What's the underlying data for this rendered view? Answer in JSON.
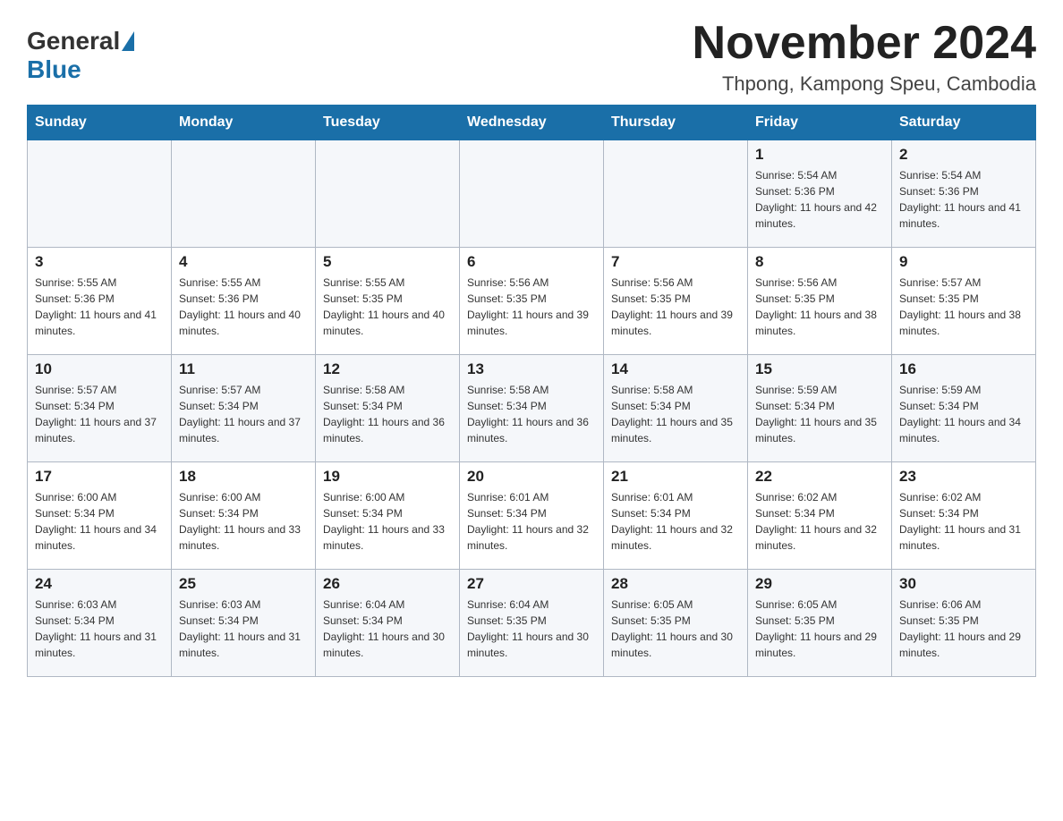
{
  "header": {
    "logo_general": "General",
    "logo_blue": "Blue",
    "month_title": "November 2024",
    "location": "Thpong, Kampong Speu, Cambodia"
  },
  "days_of_week": [
    "Sunday",
    "Monday",
    "Tuesday",
    "Wednesday",
    "Thursday",
    "Friday",
    "Saturday"
  ],
  "weeks": [
    [
      {
        "day": "",
        "sunrise": "",
        "sunset": "",
        "daylight": ""
      },
      {
        "day": "",
        "sunrise": "",
        "sunset": "",
        "daylight": ""
      },
      {
        "day": "",
        "sunrise": "",
        "sunset": "",
        "daylight": ""
      },
      {
        "day": "",
        "sunrise": "",
        "sunset": "",
        "daylight": ""
      },
      {
        "day": "",
        "sunrise": "",
        "sunset": "",
        "daylight": ""
      },
      {
        "day": "1",
        "sunrise": "Sunrise: 5:54 AM",
        "sunset": "Sunset: 5:36 PM",
        "daylight": "Daylight: 11 hours and 42 minutes."
      },
      {
        "day": "2",
        "sunrise": "Sunrise: 5:54 AM",
        "sunset": "Sunset: 5:36 PM",
        "daylight": "Daylight: 11 hours and 41 minutes."
      }
    ],
    [
      {
        "day": "3",
        "sunrise": "Sunrise: 5:55 AM",
        "sunset": "Sunset: 5:36 PM",
        "daylight": "Daylight: 11 hours and 41 minutes."
      },
      {
        "day": "4",
        "sunrise": "Sunrise: 5:55 AM",
        "sunset": "Sunset: 5:36 PM",
        "daylight": "Daylight: 11 hours and 40 minutes."
      },
      {
        "day": "5",
        "sunrise": "Sunrise: 5:55 AM",
        "sunset": "Sunset: 5:35 PM",
        "daylight": "Daylight: 11 hours and 40 minutes."
      },
      {
        "day": "6",
        "sunrise": "Sunrise: 5:56 AM",
        "sunset": "Sunset: 5:35 PM",
        "daylight": "Daylight: 11 hours and 39 minutes."
      },
      {
        "day": "7",
        "sunrise": "Sunrise: 5:56 AM",
        "sunset": "Sunset: 5:35 PM",
        "daylight": "Daylight: 11 hours and 39 minutes."
      },
      {
        "day": "8",
        "sunrise": "Sunrise: 5:56 AM",
        "sunset": "Sunset: 5:35 PM",
        "daylight": "Daylight: 11 hours and 38 minutes."
      },
      {
        "day": "9",
        "sunrise": "Sunrise: 5:57 AM",
        "sunset": "Sunset: 5:35 PM",
        "daylight": "Daylight: 11 hours and 38 minutes."
      }
    ],
    [
      {
        "day": "10",
        "sunrise": "Sunrise: 5:57 AM",
        "sunset": "Sunset: 5:34 PM",
        "daylight": "Daylight: 11 hours and 37 minutes."
      },
      {
        "day": "11",
        "sunrise": "Sunrise: 5:57 AM",
        "sunset": "Sunset: 5:34 PM",
        "daylight": "Daylight: 11 hours and 37 minutes."
      },
      {
        "day": "12",
        "sunrise": "Sunrise: 5:58 AM",
        "sunset": "Sunset: 5:34 PM",
        "daylight": "Daylight: 11 hours and 36 minutes."
      },
      {
        "day": "13",
        "sunrise": "Sunrise: 5:58 AM",
        "sunset": "Sunset: 5:34 PM",
        "daylight": "Daylight: 11 hours and 36 minutes."
      },
      {
        "day": "14",
        "sunrise": "Sunrise: 5:58 AM",
        "sunset": "Sunset: 5:34 PM",
        "daylight": "Daylight: 11 hours and 35 minutes."
      },
      {
        "day": "15",
        "sunrise": "Sunrise: 5:59 AM",
        "sunset": "Sunset: 5:34 PM",
        "daylight": "Daylight: 11 hours and 35 minutes."
      },
      {
        "day": "16",
        "sunrise": "Sunrise: 5:59 AM",
        "sunset": "Sunset: 5:34 PM",
        "daylight": "Daylight: 11 hours and 34 minutes."
      }
    ],
    [
      {
        "day": "17",
        "sunrise": "Sunrise: 6:00 AM",
        "sunset": "Sunset: 5:34 PM",
        "daylight": "Daylight: 11 hours and 34 minutes."
      },
      {
        "day": "18",
        "sunrise": "Sunrise: 6:00 AM",
        "sunset": "Sunset: 5:34 PM",
        "daylight": "Daylight: 11 hours and 33 minutes."
      },
      {
        "day": "19",
        "sunrise": "Sunrise: 6:00 AM",
        "sunset": "Sunset: 5:34 PM",
        "daylight": "Daylight: 11 hours and 33 minutes."
      },
      {
        "day": "20",
        "sunrise": "Sunrise: 6:01 AM",
        "sunset": "Sunset: 5:34 PM",
        "daylight": "Daylight: 11 hours and 32 minutes."
      },
      {
        "day": "21",
        "sunrise": "Sunrise: 6:01 AM",
        "sunset": "Sunset: 5:34 PM",
        "daylight": "Daylight: 11 hours and 32 minutes."
      },
      {
        "day": "22",
        "sunrise": "Sunrise: 6:02 AM",
        "sunset": "Sunset: 5:34 PM",
        "daylight": "Daylight: 11 hours and 32 minutes."
      },
      {
        "day": "23",
        "sunrise": "Sunrise: 6:02 AM",
        "sunset": "Sunset: 5:34 PM",
        "daylight": "Daylight: 11 hours and 31 minutes."
      }
    ],
    [
      {
        "day": "24",
        "sunrise": "Sunrise: 6:03 AM",
        "sunset": "Sunset: 5:34 PM",
        "daylight": "Daylight: 11 hours and 31 minutes."
      },
      {
        "day": "25",
        "sunrise": "Sunrise: 6:03 AM",
        "sunset": "Sunset: 5:34 PM",
        "daylight": "Daylight: 11 hours and 31 minutes."
      },
      {
        "day": "26",
        "sunrise": "Sunrise: 6:04 AM",
        "sunset": "Sunset: 5:34 PM",
        "daylight": "Daylight: 11 hours and 30 minutes."
      },
      {
        "day": "27",
        "sunrise": "Sunrise: 6:04 AM",
        "sunset": "Sunset: 5:35 PM",
        "daylight": "Daylight: 11 hours and 30 minutes."
      },
      {
        "day": "28",
        "sunrise": "Sunrise: 6:05 AM",
        "sunset": "Sunset: 5:35 PM",
        "daylight": "Daylight: 11 hours and 30 minutes."
      },
      {
        "day": "29",
        "sunrise": "Sunrise: 6:05 AM",
        "sunset": "Sunset: 5:35 PM",
        "daylight": "Daylight: 11 hours and 29 minutes."
      },
      {
        "day": "30",
        "sunrise": "Sunrise: 6:06 AM",
        "sunset": "Sunset: 5:35 PM",
        "daylight": "Daylight: 11 hours and 29 minutes."
      }
    ]
  ]
}
